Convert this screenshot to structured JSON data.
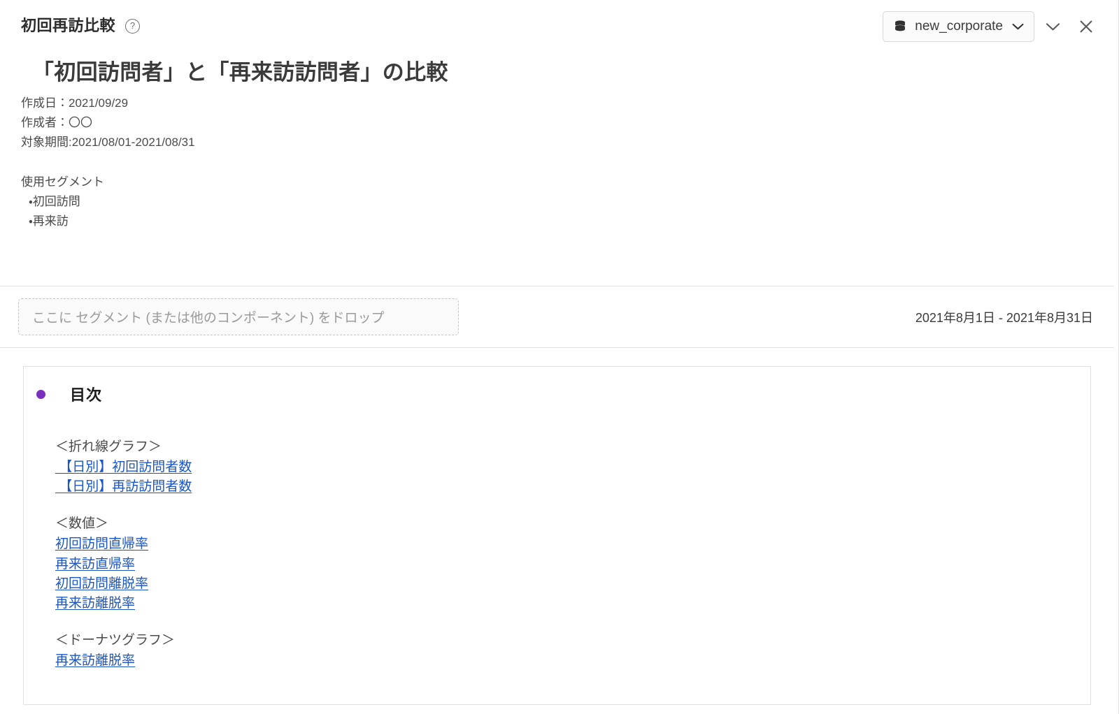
{
  "window": {
    "panel_title": "初回再訪比較",
    "help_icon": "question-mark-circle-icon",
    "database_icon": "database-icon",
    "database_name": "new_corporate",
    "database_chevron_icon": "chevron-down-icon",
    "collapse_icon": "chevron-down-icon",
    "close_icon": "close-icon"
  },
  "report": {
    "title": "「初回訪問者」と「再来訪訪問者」の比較",
    "created_date_line": "作成日：2021/09/29",
    "author_line": "作成者：〇〇",
    "period_line": "対象期間:2021/08/01-2021/08/31",
    "segments_heading": "使用セグメント",
    "segments": [
      "・初回訪問",
      "・再来訪"
    ]
  },
  "dropband": {
    "dropzone_label": "ここに セグメント (または他のコンポーネント) をドロップ",
    "date_range": "2021年8月1日 - 2021年8月31日"
  },
  "toc": {
    "bullet_color": "#7b2fbe",
    "title": "目次",
    "groups": [
      {
        "heading": "＜折れ線グラフ＞",
        "links": [
          " 【日別】初回訪問者数",
          " 【日別】再訪訪問者数"
        ]
      },
      {
        "heading": "＜数値＞",
        "links": [
          "初回訪問直帰率",
          "再来訪直帰率",
          "初回訪問離脱率",
          "再来訪離脱率"
        ]
      },
      {
        "heading": "＜ドーナツグラフ＞",
        "links": [
          "再来訪離脱率"
        ]
      }
    ]
  },
  "colors": {
    "link": "#1b56c4",
    "accent": "#7b2fbe",
    "text": "#4a4a4a",
    "heading": "#3b3b3b",
    "border": "#e0e0e0"
  }
}
